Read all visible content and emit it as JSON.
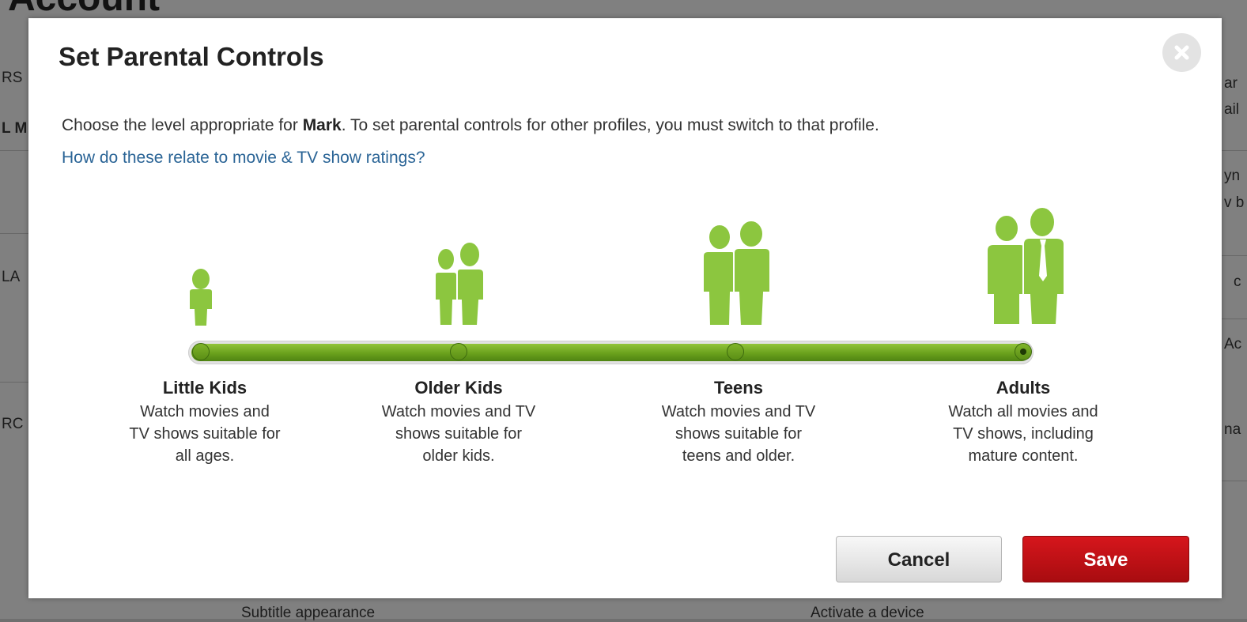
{
  "background": {
    "page_title": "Account",
    "fragments": [
      "RS",
      "L M",
      "LA",
      "RC",
      "ar",
      "ail",
      "yn",
      "v b",
      "c",
      "Ac",
      "na",
      "Subtitle appearance",
      "Activate a device"
    ]
  },
  "modal": {
    "title": "Set Parental Controls",
    "intro_before": "Choose the level appropriate for ",
    "profile_name": "Mark",
    "intro_after": ". To set parental controls for other profiles, you must switch to that profile.",
    "help_link": "How do these relate to movie & TV show ratings?",
    "selected_level": "Adults",
    "levels": [
      {
        "name": "Little Kids",
        "desc": [
          "Watch movies and",
          "TV shows suitable for",
          "all ages."
        ]
      },
      {
        "name": "Older Kids",
        "desc": [
          "Watch movies and TV",
          "shows suitable for",
          "older kids."
        ]
      },
      {
        "name": "Teens",
        "desc": [
          "Watch movies and TV",
          "shows suitable for",
          "teens and older."
        ]
      },
      {
        "name": "Adults",
        "desc": [
          "Watch all movies and",
          "TV shows, including",
          "mature content."
        ]
      }
    ],
    "cancel_label": "Cancel",
    "save_label": "Save"
  },
  "colors": {
    "figure_green": "#8cc63f",
    "track_green": "#6aa11d",
    "save_red": "#c4111a",
    "link_blue": "#2a6496"
  },
  "icons": [
    "close-icon",
    "little-kids-icon",
    "older-kids-icon",
    "teens-icon",
    "adults-icon"
  ]
}
